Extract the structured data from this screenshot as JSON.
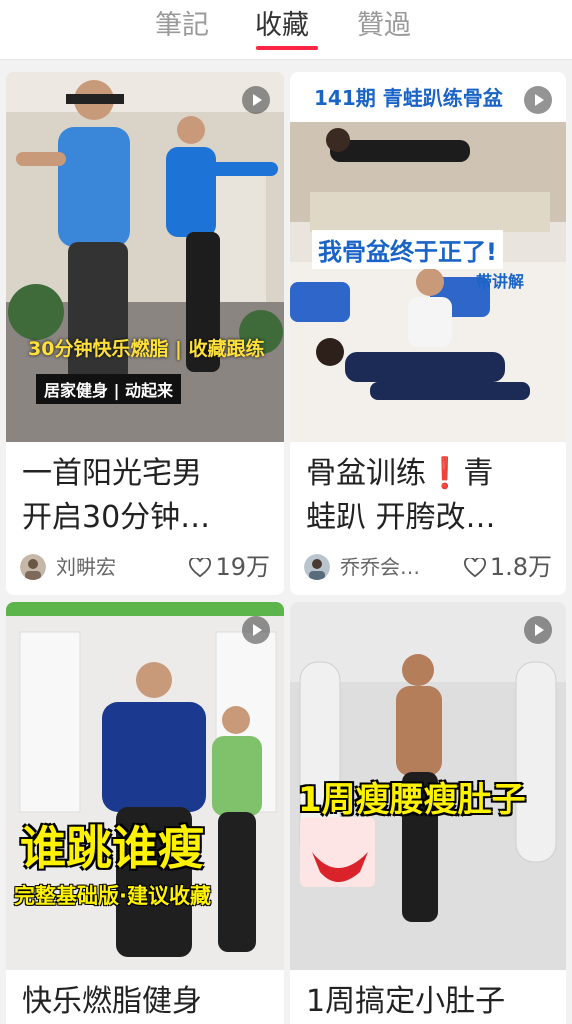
{
  "tabs": [
    {
      "label": "筆記",
      "active": false
    },
    {
      "label": "收藏",
      "active": true
    },
    {
      "label": "贊過",
      "active": false
    }
  ],
  "accent_color": "#ff2442",
  "cards": [
    {
      "overlay": [
        "30分钟快乐燃脂 | 收藏跟练",
        "居家健身 | 动起来"
      ],
      "title_lines": [
        "一首阳光宅男",
        "开启30分钟…"
      ],
      "author": "刘畊宏",
      "likes": "19万",
      "icon": "play-icon"
    },
    {
      "overlay": [
        "141期 青蛙趴练骨盆",
        "我骨盆终于正了!",
        "带讲解"
      ],
      "title_lines": [
        "骨盆训练❗青",
        "蛙趴 开胯改…"
      ],
      "author": "乔乔会…",
      "likes": "1.8万",
      "icon": "play-icon"
    },
    {
      "overlay": [
        "谁跳谁瘦",
        "完整基础版·建议收藏"
      ],
      "title_lines": [
        "快乐燃脂健身"
      ],
      "author": "",
      "likes": "",
      "icon": "play-icon"
    },
    {
      "overlay": [
        "1周瘦腰瘦肚子"
      ],
      "title_lines": [
        "1周搞定小肚子"
      ],
      "author": "",
      "likes": "",
      "icon": "play-icon"
    }
  ]
}
